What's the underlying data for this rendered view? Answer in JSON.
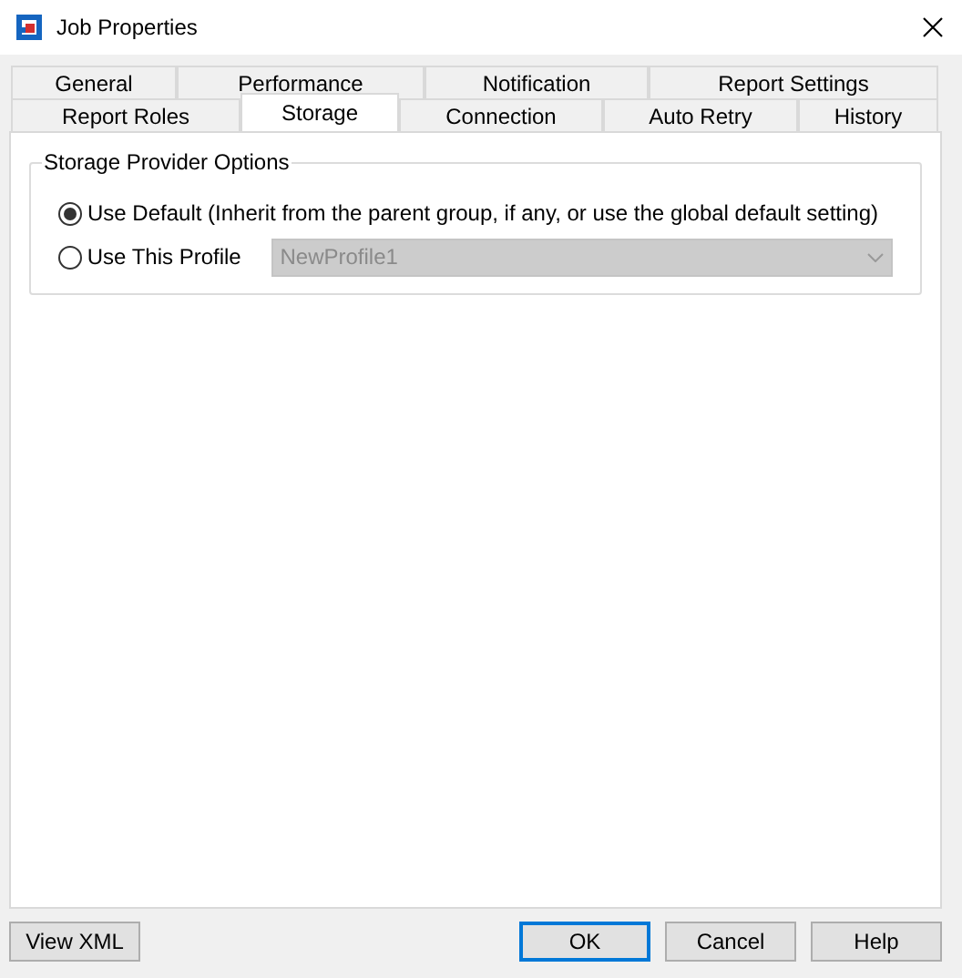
{
  "window": {
    "title": "Job Properties"
  },
  "tab_rows": [
    [
      {
        "label": "General",
        "selected": false
      },
      {
        "label": "Performance",
        "selected": false
      },
      {
        "label": "Notification",
        "selected": false
      },
      {
        "label": "Report Settings",
        "selected": false
      }
    ],
    [
      {
        "label": "Report Roles",
        "selected": false
      },
      {
        "label": "Storage",
        "selected": true
      },
      {
        "label": "Connection",
        "selected": false
      },
      {
        "label": "Auto Retry",
        "selected": false
      },
      {
        "label": "History",
        "selected": false
      }
    ]
  ],
  "group": {
    "title": "Storage Provider Options",
    "options": [
      {
        "label": "Use Default (Inherit from the parent group, if any, or use the global default setting)",
        "selected": true
      },
      {
        "label": "Use This Profile",
        "selected": false
      }
    ],
    "profile": {
      "value": "NewProfile1",
      "disabled": true
    }
  },
  "buttons": [
    {
      "label": "View XML",
      "default": false
    },
    {
      "label": "OK",
      "default": true
    },
    {
      "label": "Cancel",
      "default": false
    },
    {
      "label": "Help",
      "default": false
    }
  ]
}
